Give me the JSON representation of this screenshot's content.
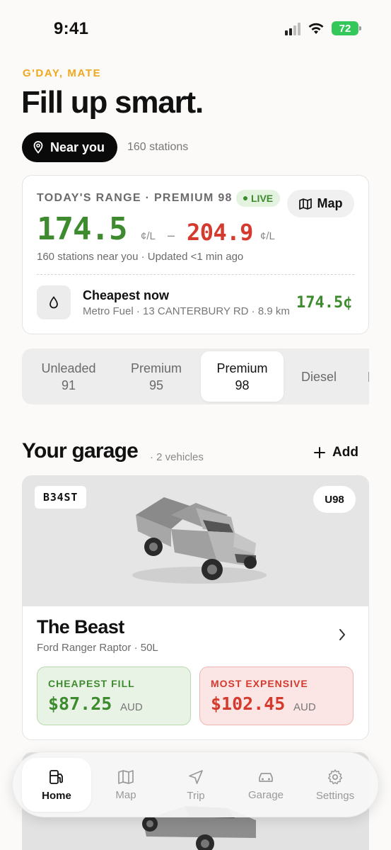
{
  "status_bar": {
    "time": "9:41",
    "battery": "72"
  },
  "header": {
    "greeting": "G'DAY, MATE",
    "headline": "Fill up smart.",
    "location_pill": "Near you",
    "station_count": "160 stations"
  },
  "range_card": {
    "label": "TODAY'S RANGE · PREMIUM 98",
    "live_badge": "LIVE",
    "map_button": "Map",
    "price_low": "174.5",
    "price_high": "204.9",
    "unit": "¢/L",
    "separator": "–",
    "subtext": "160 stations near you · Updated <1 min ago",
    "cheapest": {
      "title": "Cheapest now",
      "detail": "Metro Fuel · 13 CANTERBURY RD · 8.9 km",
      "price": "174.5¢"
    }
  },
  "fuel_tabs": [
    {
      "line1": "Unleaded",
      "line2": "91"
    },
    {
      "line1": "Premium",
      "line2": "95"
    },
    {
      "line1": "Premium",
      "line2": "98"
    },
    {
      "line1": "Diesel",
      "line2": ""
    }
  ],
  "garage": {
    "title": "Your garage",
    "count": "· 2 vehicles",
    "add_label": "Add",
    "vehicle": {
      "plate": "B34ST",
      "fuel": "U98",
      "name": "The Beast",
      "model": "Ford Ranger Raptor · 50L",
      "cheapest_label": "CHEAPEST FILL",
      "cheapest_value": "$87.25",
      "expensive_label": "MOST EXPENSIVE",
      "expensive_value": "$102.45",
      "currency": "AUD"
    }
  },
  "tabbar": {
    "items": [
      {
        "label": "Home",
        "icon": "fuel-pump-icon"
      },
      {
        "label": "Map",
        "icon": "map-icon"
      },
      {
        "label": "Trip",
        "icon": "navigation-arrow-icon"
      },
      {
        "label": "Garage",
        "icon": "car-icon"
      },
      {
        "label": "Settings",
        "icon": "gear-icon"
      }
    ]
  },
  "colors": {
    "accent_green": "#3e8a2e",
    "accent_red": "#d43a2d",
    "greeting_yellow": "#f0a81e"
  }
}
